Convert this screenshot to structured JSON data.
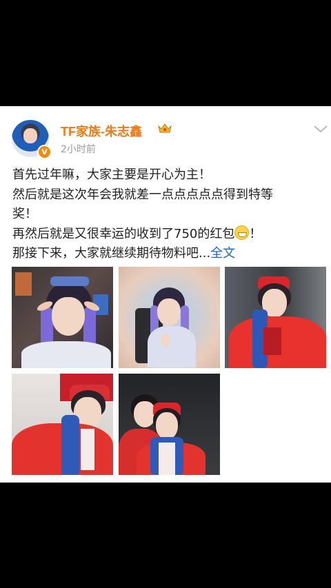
{
  "post": {
    "author": "TF家族-朱志鑫",
    "time": "2小时前",
    "verified_badge": "V",
    "lines": [
      "首先过年嘛，大家主要是开心为主！",
      "然后就是这次年会我就差一点点点点点得到特等",
      "奖！",
      "再然后就是又很幸运的收到了750的红包",
      "那接下来，大家就继续期待物料吧..."
    ],
    "line4_tail": "！",
    "more_label": "全文",
    "accent_color": "#f07a14",
    "link_color": "#1d65c5"
  },
  "icons": {
    "crown": "crown-icon",
    "chevron": "chevron-down-icon",
    "emoji": "grin-emoji-icon"
  },
  "photos": [
    {
      "label": "elf-costume-photo-1"
    },
    {
      "label": "elf-costume-photo-2"
    },
    {
      "label": "red-hoodie-photo-1"
    },
    {
      "label": "red-hoodie-photo-2"
    },
    {
      "label": "red-hoodie-photo-3"
    }
  ]
}
